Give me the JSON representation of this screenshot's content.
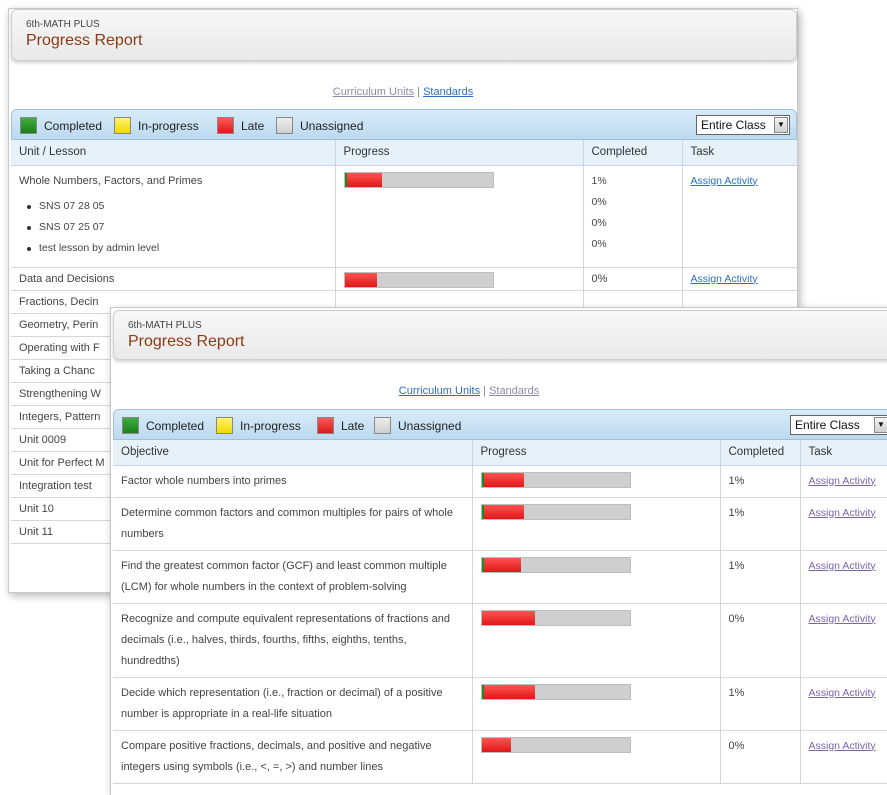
{
  "back": {
    "course": "6th-MATH PLUS",
    "title": "Progress Report",
    "links": {
      "curriculum": "Curriculum Units",
      "sep": "|",
      "standards": "Standards"
    },
    "legend": {
      "completed": "Completed",
      "inprogress": "In-progress",
      "late": "Late",
      "unassigned": "Unassigned"
    },
    "selector": "Entire Class",
    "headers": {
      "unit": "Unit / Lesson",
      "progress": "Progress",
      "completed": "Completed",
      "task": "Task"
    },
    "first_unit": {
      "name": "Whole Numbers, Factors, and Primes",
      "percent": "1%",
      "task": "Assign Activity",
      "late": 0.25,
      "done": 0.01,
      "lessons": [
        {
          "name": "SNS 07 28 05",
          "percent": "0%"
        },
        {
          "name": "SNS 07 25 07",
          "percent": "0%"
        },
        {
          "name": "test lesson by admin level",
          "percent": "0%"
        }
      ]
    },
    "second_unit": {
      "name": "Data and Decisions",
      "percent": "0%",
      "task": "Assign Activity",
      "late": 0.22
    },
    "other_units": [
      "Fractions, Decin",
      "Geometry, Perin",
      "Operating with F",
      "Taking a Chanc",
      "Strengthening W",
      "Integers, Pattern",
      "Unit 0009",
      "Unit for Perfect M",
      "Integration test",
      "Unit 10",
      "Unit 11"
    ]
  },
  "front": {
    "course": "6th-MATH PLUS",
    "title": "Progress Report",
    "links": {
      "curriculum": "Curriculum Units",
      "sep": "|",
      "standards": "Standards"
    },
    "legend": {
      "completed": "Completed",
      "inprogress": "In-progress",
      "late": "Late",
      "unassigned": "Unassigned"
    },
    "selector": "Entire Class",
    "headers": {
      "objective": "Objective",
      "progress": "Progress",
      "completed": "Completed",
      "task": "Task"
    },
    "rows": [
      {
        "objective": "Factor whole numbers into primes",
        "percent": "1%",
        "task": "Assign Activity",
        "late": 0.29,
        "done": 0.01
      },
      {
        "objective": "Determine common factors and common multiples for pairs of whole numbers",
        "percent": "1%",
        "task": "Assign Activity",
        "late": 0.29,
        "done": 0.01
      },
      {
        "objective": "Find the greatest common factor (GCF) and least common multiple (LCM) for whole numbers in the context of problem-solving",
        "percent": "1%",
        "task": "Assign Activity",
        "late": 0.27,
        "done": 0.01
      },
      {
        "objective": "Recognize and compute equivalent representations of fractions and decimals (i.e., halves, thirds, fourths, fifths, eighths, tenths, hundredths)",
        "percent": "0%",
        "task": "Assign Activity",
        "late": 0.36,
        "done": 0
      },
      {
        "objective": "Decide which representation (i.e., fraction or decimal) of a positive number is appropriate in a real-life situation",
        "percent": "1%",
        "task": "Assign Activity",
        "late": 0.36,
        "done": 0.01
      },
      {
        "objective": "Compare positive fractions, decimals, and positive and negative integers using symbols (i.e., <, =, >) and number lines",
        "percent": "0%",
        "task": "Assign Activity",
        "late": 0.2,
        "done": 0
      }
    ]
  },
  "colors": {
    "completed": "#1e8b1e",
    "inprogress": "#f1d800",
    "late": "#e01717",
    "unassigned": "#cfcfcf",
    "link": "#2a6fc4",
    "title": "#8a3a14"
  }
}
